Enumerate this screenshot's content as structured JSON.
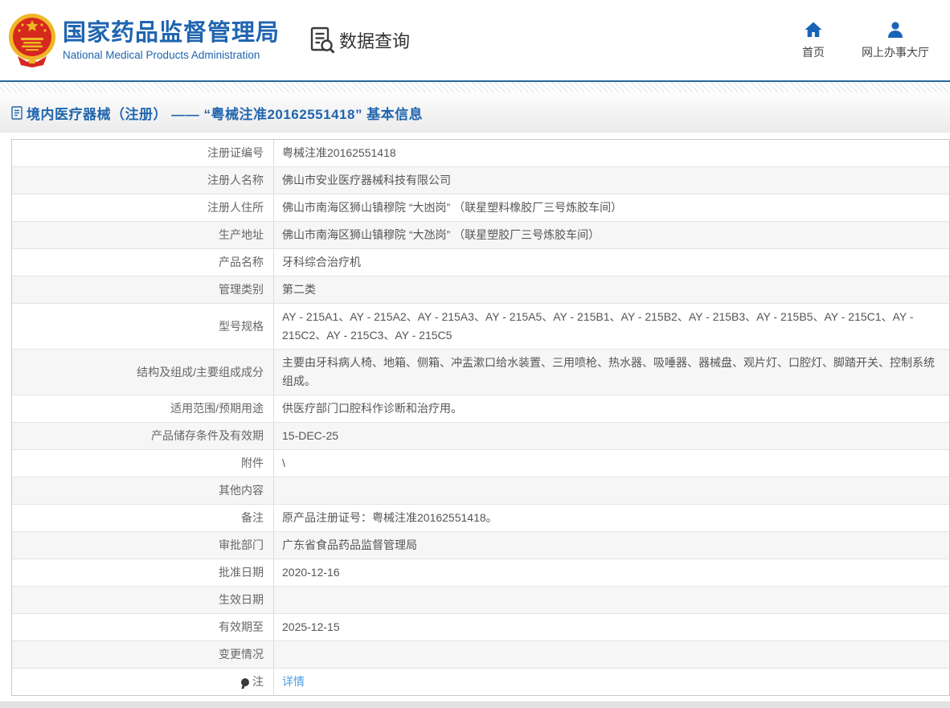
{
  "header": {
    "org_name_zh": "国家药品监督管理局",
    "org_name_en": "National Medical Products Administration",
    "data_query_label": "数据查询",
    "nav_home_label": "首页",
    "nav_hall_label": "网上办事大厅"
  },
  "page_title": "境内医疗器械（注册） —— “粤械注准20162551418” 基本信息",
  "colors": {
    "brand_blue": "#2065b0",
    "title_blue": "#2166ae",
    "divider_blue": "#27689a",
    "link_blue": "#4a9ce8",
    "emblem_red": "#d6291e",
    "emblem_gold": "#f0b626"
  },
  "icons": {
    "emblem": "china-national-emblem",
    "data_query": "document-magnifier-icon",
    "home": "home-icon",
    "hall": "person-icon",
    "title": "document-icon",
    "note": "bulb-icon"
  },
  "table": {
    "rows": [
      {
        "label": "注册证编号",
        "value": "粤械注准20162551418"
      },
      {
        "label": "注册人名称",
        "value": "佛山市安业医疗器械科技有限公司"
      },
      {
        "label": "注册人住所",
        "value": "佛山市南海区狮山镇穆院 “大凼岗” （联星塑料橡胶厂三号炼胶车间）"
      },
      {
        "label": "生产地址",
        "value": "佛山市南海区狮山镇穆院 “大氹岗” （联星塑胶厂三号炼胶车间）"
      },
      {
        "label": "产品名称",
        "value": "牙科综合治疗机"
      },
      {
        "label": "管理类别",
        "value": "第二类"
      },
      {
        "label": "型号规格",
        "value": "AY - 215A1、AY - 215A2、AY - 215A3、AY - 215A5、AY - 215B1、AY - 215B2、AY - 215B3、AY - 215B5、AY - 215C1、AY - 215C2、AY - 215C3、AY - 215C5"
      },
      {
        "label": "结构及组成/主要组成成分",
        "value": "主要由牙科病人椅、地箱、侧箱、冲盂漱口给水装置、三用喷枪、热水器、吸唾器、器械盘、观片灯、口腔灯、脚踏开关、控制系统组成。"
      },
      {
        "label": "适用范围/预期用途",
        "value": "供医疗部门口腔科作诊断和治疗用。"
      },
      {
        "label": "产品储存条件及有效期",
        "value": "15-DEC-25"
      },
      {
        "label": "附件",
        "value": "\\"
      },
      {
        "label": "其他内容",
        "value": ""
      },
      {
        "label": "备注",
        "value": "原产品注册证号：粤械注准20162551418。"
      },
      {
        "label": "审批部门",
        "value": "广东省食品药品监督管理局"
      },
      {
        "label": "批准日期",
        "value": "2020-12-16"
      },
      {
        "label": "生效日期",
        "value": ""
      },
      {
        "label": "有效期至",
        "value": "2025-12-15"
      },
      {
        "label": "变更情况",
        "value": ""
      },
      {
        "label": "注",
        "label_icon": "bulb-icon",
        "value": "详情",
        "value_type": "link"
      }
    ]
  }
}
